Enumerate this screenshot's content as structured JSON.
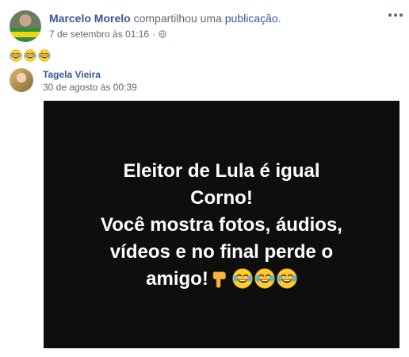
{
  "post": {
    "author": "Marcelo Morelo",
    "action": "compartilhou uma",
    "link_text": "publicação",
    "link_suffix": ".",
    "timestamp": "7 de setembro às 01:16",
    "separator": "·",
    "privacy_icon": "globe-icon",
    "more_icon": "more-options-icon",
    "emojis": [
      "tears-of-joy-emoji",
      "tears-of-joy-emoji",
      "tears-of-joy-emoji"
    ]
  },
  "shared": {
    "author": "Tagela Vieira",
    "timestamp": "30 de agosto às 00:39"
  },
  "meme": {
    "lines": [
      "Eleitor de Lula é igual",
      "Corno!",
      "Você mostra fotos, áudios,",
      "vídeos e no final perde o",
      "amigo!"
    ],
    "trailing_emojis": [
      "pointing-down-emoji",
      "tears-of-joy-emoji",
      "tears-of-joy-emoji",
      "tears-of-joy-emoji"
    ]
  },
  "colors": {
    "link": "#385898",
    "meta": "#616770",
    "meme_background": "#0e0e0e",
    "meme_text": "#ffffff"
  }
}
